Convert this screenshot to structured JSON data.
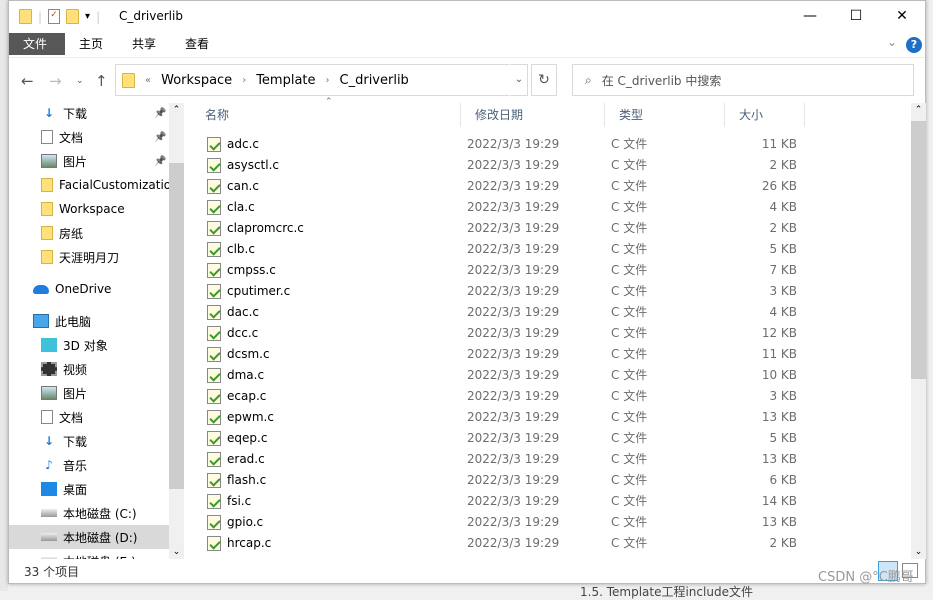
{
  "window": {
    "title": "C_driverlib",
    "minimize": "—",
    "maximize": "☐",
    "close": "✕"
  },
  "ribbon": {
    "tabs": [
      "文件",
      "主页",
      "共享",
      "查看"
    ],
    "help": "?",
    "expand": "⌄"
  },
  "address": {
    "overflow": "«",
    "crumbs": [
      "Workspace",
      "Template",
      "C_driverlib"
    ],
    "search_placeholder": "在 C_driverlib 中搜索"
  },
  "nav": [
    {
      "label": "下载",
      "icon": "download-icon",
      "pinned": true
    },
    {
      "label": "文档",
      "icon": "document-icon",
      "pinned": true
    },
    {
      "label": "图片",
      "icon": "picture-icon",
      "pinned": true
    },
    {
      "label": "FacialCustomization",
      "icon": "folder-icon"
    },
    {
      "label": "Workspace",
      "icon": "folder-icon"
    },
    {
      "label": "房纸",
      "icon": "folder-icon"
    },
    {
      "label": "天涯明月刀",
      "icon": "folder-icon"
    },
    {
      "label": "OneDrive",
      "icon": "cloud-icon"
    },
    {
      "label": "此电脑",
      "icon": "computer-icon"
    },
    {
      "label": "3D 对象",
      "icon": "cube-icon"
    },
    {
      "label": "视频",
      "icon": "video-icon"
    },
    {
      "label": "图片",
      "icon": "picture-icon"
    },
    {
      "label": "文档",
      "icon": "document-icon"
    },
    {
      "label": "下载",
      "icon": "download-icon"
    },
    {
      "label": "音乐",
      "icon": "music-icon"
    },
    {
      "label": "桌面",
      "icon": "desktop-icon"
    },
    {
      "label": "本地磁盘 (C:)",
      "icon": "drive-icon"
    },
    {
      "label": "本地磁盘 (D:)",
      "icon": "drive-icon",
      "selected": true
    },
    {
      "label": "本地磁盘 (E:)",
      "icon": "drive-icon"
    }
  ],
  "columns": [
    "名称",
    "修改日期",
    "类型",
    "大小"
  ],
  "files": [
    {
      "name": "adc.c",
      "date": "2022/3/3 19:29",
      "type": "C 文件",
      "size": "11 KB"
    },
    {
      "name": "asysctl.c",
      "date": "2022/3/3 19:29",
      "type": "C 文件",
      "size": "2 KB"
    },
    {
      "name": "can.c",
      "date": "2022/3/3 19:29",
      "type": "C 文件",
      "size": "26 KB"
    },
    {
      "name": "cla.c",
      "date": "2022/3/3 19:29",
      "type": "C 文件",
      "size": "4 KB"
    },
    {
      "name": "clapromcrc.c",
      "date": "2022/3/3 19:29",
      "type": "C 文件",
      "size": "2 KB"
    },
    {
      "name": "clb.c",
      "date": "2022/3/3 19:29",
      "type": "C 文件",
      "size": "5 KB"
    },
    {
      "name": "cmpss.c",
      "date": "2022/3/3 19:29",
      "type": "C 文件",
      "size": "7 KB"
    },
    {
      "name": "cputimer.c",
      "date": "2022/3/3 19:29",
      "type": "C 文件",
      "size": "3 KB"
    },
    {
      "name": "dac.c",
      "date": "2022/3/3 19:29",
      "type": "C 文件",
      "size": "4 KB"
    },
    {
      "name": "dcc.c",
      "date": "2022/3/3 19:29",
      "type": "C 文件",
      "size": "12 KB"
    },
    {
      "name": "dcsm.c",
      "date": "2022/3/3 19:29",
      "type": "C 文件",
      "size": "11 KB"
    },
    {
      "name": "dma.c",
      "date": "2022/3/3 19:29",
      "type": "C 文件",
      "size": "10 KB"
    },
    {
      "name": "ecap.c",
      "date": "2022/3/3 19:29",
      "type": "C 文件",
      "size": "3 KB"
    },
    {
      "name": "epwm.c",
      "date": "2022/3/3 19:29",
      "type": "C 文件",
      "size": "13 KB"
    },
    {
      "name": "eqep.c",
      "date": "2022/3/3 19:29",
      "type": "C 文件",
      "size": "5 KB"
    },
    {
      "name": "erad.c",
      "date": "2022/3/3 19:29",
      "type": "C 文件",
      "size": "13 KB"
    },
    {
      "name": "flash.c",
      "date": "2022/3/3 19:29",
      "type": "C 文件",
      "size": "6 KB"
    },
    {
      "name": "fsi.c",
      "date": "2022/3/3 19:29",
      "type": "C 文件",
      "size": "14 KB"
    },
    {
      "name": "gpio.c",
      "date": "2022/3/3 19:29",
      "type": "C 文件",
      "size": "13 KB"
    },
    {
      "name": "hrcap.c",
      "date": "2022/3/3 19:29",
      "type": "C 文件",
      "size": "2 KB"
    }
  ],
  "status": {
    "count": "33 个项目"
  },
  "watermark": "CSDN @°C鹏哥",
  "background_text": "1.5. Template工程include文件"
}
